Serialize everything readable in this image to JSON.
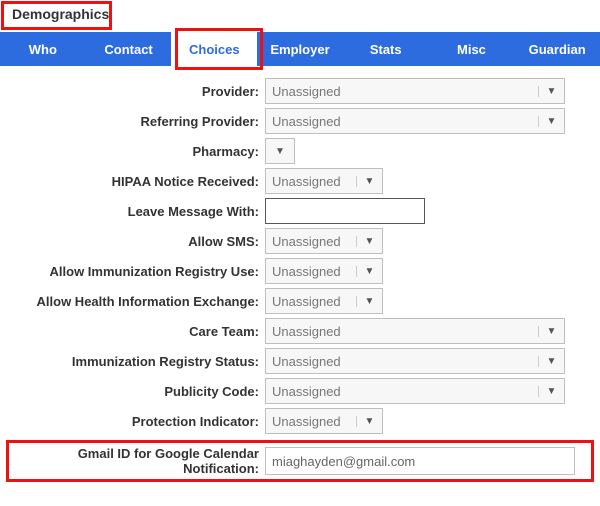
{
  "panel": {
    "title": "Demographics"
  },
  "tabs": [
    {
      "label": "Who"
    },
    {
      "label": "Contact"
    },
    {
      "label": "Choices",
      "active": true
    },
    {
      "label": "Employer"
    },
    {
      "label": "Stats"
    },
    {
      "label": "Misc"
    },
    {
      "label": "Guardian"
    }
  ],
  "form": {
    "provider": {
      "label": "Provider:",
      "value": "Unassigned"
    },
    "referring": {
      "label": "Referring Provider:",
      "value": "Unassigned"
    },
    "pharmacy": {
      "label": "Pharmacy:"
    },
    "hipaa": {
      "label": "HIPAA Notice Received:",
      "value": "Unassigned"
    },
    "leaveMsg": {
      "label": "Leave Message With:",
      "value": ""
    },
    "allowSms": {
      "label": "Allow SMS:",
      "value": "Unassigned"
    },
    "allowImmReg": {
      "label": "Allow Immunization Registry Use:",
      "value": "Unassigned"
    },
    "allowHie": {
      "label": "Allow Health Information Exchange:",
      "value": "Unassigned"
    },
    "careTeam": {
      "label": "Care Team:",
      "value": "Unassigned"
    },
    "immRegStatus": {
      "label": "Immunization Registry Status:",
      "value": "Unassigned"
    },
    "publicity": {
      "label": "Publicity Code:",
      "value": "Unassigned"
    },
    "protection": {
      "label": "Protection Indicator:",
      "value": "Unassigned"
    },
    "gmail": {
      "label": "Gmail ID for Google Calendar Notification:",
      "value": "miaghayden@gmail.com"
    }
  },
  "caret": "▼"
}
